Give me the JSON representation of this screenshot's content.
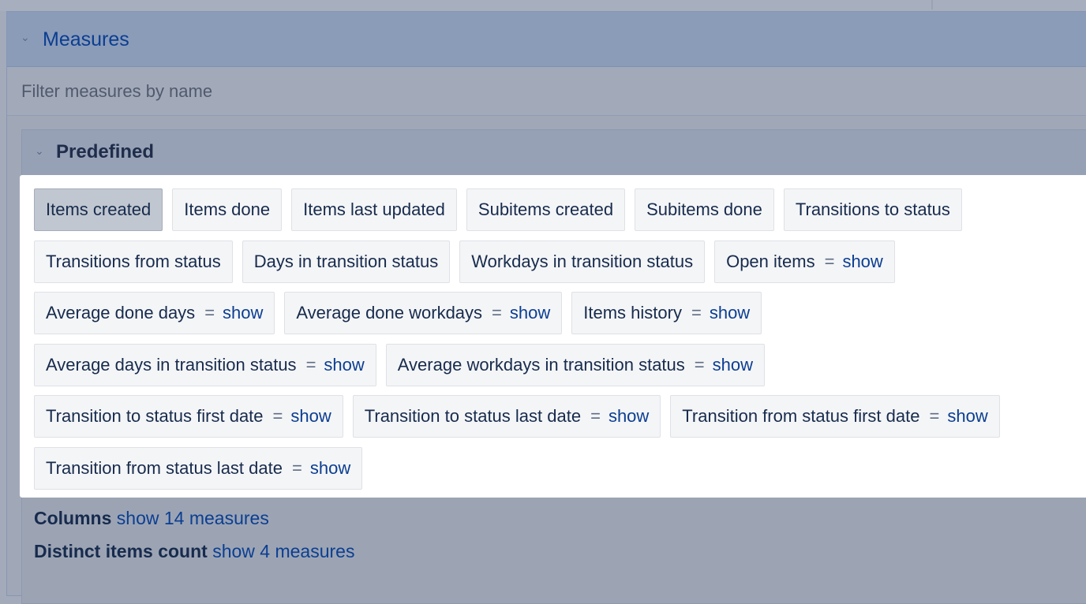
{
  "panel": {
    "title": "Measures"
  },
  "filter": {
    "placeholder": "Filter measures by name"
  },
  "group": {
    "title": "Predefined"
  },
  "eq": "=",
  "show": "show",
  "chips": {
    "items_created": "Items created",
    "items_done": "Items done",
    "items_last_updated": "Items last updated",
    "subitems_created": "Subitems created",
    "subitems_done": "Subitems done",
    "transitions_to_status": "Transitions to status",
    "transitions_from_status": "Transitions from status",
    "days_in_transition_status": "Days in transition status",
    "workdays_in_transition_status": "Workdays in transition status",
    "open_items": "Open items",
    "average_done_days": "Average done days",
    "average_done_workdays": "Average done workdays",
    "items_history": "Items history",
    "average_days_in_transition_status": "Average days in transition status",
    "average_workdays_in_transition_status": "Average workdays in transition status",
    "transition_to_status_first_date": "Transition to status first date",
    "transition_to_status_last_date": "Transition to status last date",
    "transition_from_status_first_date": "Transition from status first date",
    "transition_from_status_last_date": "Transition from status last date"
  },
  "categories": {
    "columns": {
      "label": "Columns",
      "link": "show 14 measures"
    },
    "distinct": {
      "label": "Distinct items count",
      "link": "show 4 measures"
    }
  }
}
